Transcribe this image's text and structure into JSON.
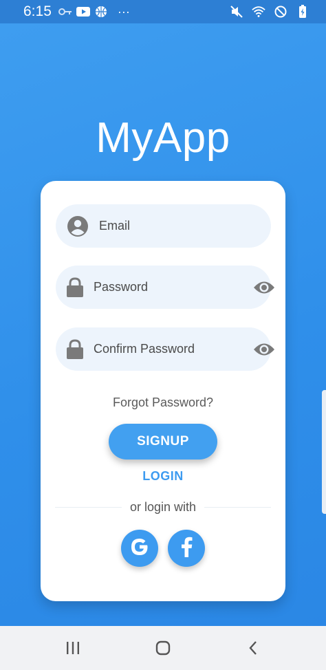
{
  "status_bar": {
    "time": "6:15",
    "left_icons": [
      "key-icon",
      "youtube-icon",
      "basketball-icon",
      "more-icon"
    ],
    "right_icons": [
      "mute-icon",
      "wifi-icon",
      "no-disturb-icon",
      "battery-icon"
    ],
    "more": "···"
  },
  "app": {
    "title": "MyApp"
  },
  "form": {
    "email": {
      "placeholder": "Email",
      "icon": "person-icon"
    },
    "password": {
      "placeholder": "Password",
      "icon": "lock-icon",
      "toggle_icon": "eye-icon"
    },
    "confirm_password": {
      "placeholder": "Confirm Password",
      "icon": "lock-icon",
      "toggle_icon": "eye-icon"
    },
    "forgot_password": "Forgot Password?",
    "signup_button": "SIGNUP",
    "login_link": "LOGIN",
    "divider_text": "or login with",
    "social": [
      "google-icon",
      "facebook-icon"
    ]
  },
  "nav_bar": [
    "recents-icon",
    "home-icon",
    "back-icon"
  ],
  "colors": {
    "background": "#3399ee",
    "accent": "#42a0f0",
    "card": "#ffffff",
    "field_bg": "#edf4fc",
    "icon_gray": "#7a7a7a"
  }
}
